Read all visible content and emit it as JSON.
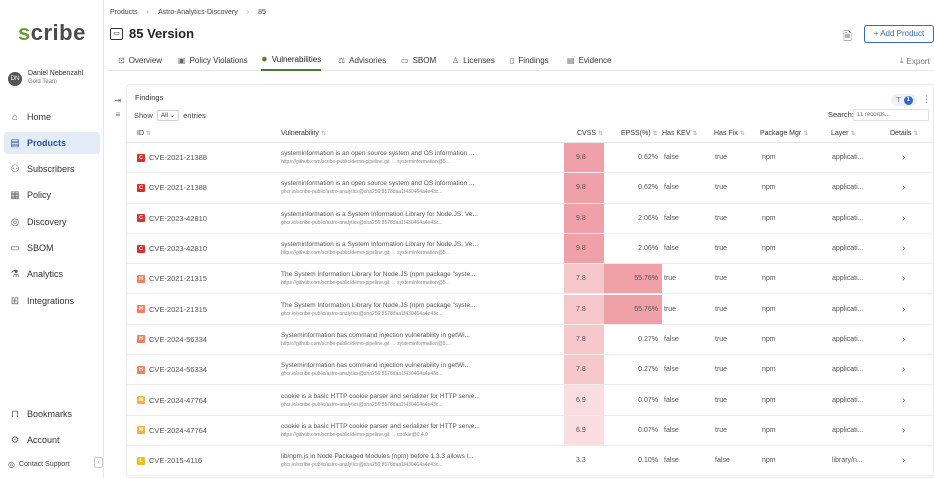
{
  "sidebar": {
    "logo_initial": "s",
    "logo_rest": "cribe",
    "user": {
      "initials": "DN",
      "name": "Daniel Nebenzahl",
      "team": "Gold Team"
    },
    "items": [
      {
        "label": "Home",
        "icon": "home-icon"
      },
      {
        "label": "Products",
        "icon": "products-icon",
        "active": true
      },
      {
        "label": "Subscribers",
        "icon": "subscribers-icon"
      },
      {
        "label": "Policy",
        "icon": "policy-icon"
      },
      {
        "label": "Discovery",
        "icon": "discovery-icon"
      },
      {
        "label": "SBOM",
        "icon": "sbom-icon"
      },
      {
        "label": "Analytics",
        "icon": "analytics-icon"
      },
      {
        "label": "Integrations",
        "icon": "integrations-icon"
      }
    ],
    "bottom": [
      {
        "label": "Bookmarks",
        "icon": "bookmark-icon"
      },
      {
        "label": "Account",
        "icon": "account-icon"
      }
    ],
    "contact_support": "Contact Support"
  },
  "header": {
    "breadcrumb": [
      "Products",
      "Astro-Analytics-Discovery",
      "85"
    ],
    "title": "85 Version",
    "add_product": "+ Add Product",
    "export": "Export"
  },
  "tabs": [
    {
      "label": "Overview",
      "icon": "overview-icon"
    },
    {
      "label": "Policy Violations",
      "icon": "policy-violations-icon"
    },
    {
      "label": "Vulnerabilities",
      "icon": "vulnerabilities-icon",
      "active": true
    },
    {
      "label": "Advisories",
      "icon": "advisories-icon"
    },
    {
      "label": "SBOM",
      "icon": "sbom-icon"
    },
    {
      "label": "Licenses",
      "icon": "licenses-icon"
    },
    {
      "label": "Findings",
      "icon": "findings-icon"
    },
    {
      "label": "Evidence",
      "icon": "evidence-icon"
    }
  ],
  "findings": {
    "title": "Findings",
    "show_label": "Show",
    "show_value": "All",
    "entries_label": "entries",
    "search_label": "Search:",
    "search_placeholder": "11 records...",
    "filter_count": "1",
    "columns": [
      "ID",
      "Vulnerability",
      "CVSS",
      "EPSS(%)",
      "Has KEV",
      "Has Fix",
      "Package Mgr",
      "Layer",
      "Details"
    ],
    "rows": [
      {
        "sev": "C",
        "sev_color": "#d9302c",
        "id": "CVE-2021-21388",
        "title": "systeminformation is an open source system and OS information ...",
        "src": "https://github.com/scribe-public/demo-pipeline.git → systeminformation@5...",
        "cvss": "9.8",
        "cvss_bg": "#f0a0a8",
        "epss": "0.62%",
        "epss_bg": "",
        "kev": "false",
        "fix": "true",
        "pm": "npm",
        "layer": "applicati..."
      },
      {
        "sev": "C",
        "sev_color": "#d9302c",
        "id": "CVE-2021-21388",
        "title": "systeminformation is an open source system and OS information ...",
        "src": "ghcr.io/scribe-public/astro-analytics@sha256:8578daa1f430464a4e43c...",
        "cvss": "9.8",
        "cvss_bg": "#f0a0a8",
        "epss": "0.62%",
        "epss_bg": "",
        "kev": "false",
        "fix": "true",
        "pm": "npm",
        "layer": "applicati..."
      },
      {
        "sev": "C",
        "sev_color": "#d9302c",
        "id": "CVE-2023-42810",
        "title": "systeminformation is a System Information Library for Node.JS. Ve...",
        "src": "ghcr.io/scribe-public/astro-analytics@sha256:8578daa1f430464a4e43c...",
        "cvss": "9.8",
        "cvss_bg": "#f0a0a8",
        "epss": "2.06%",
        "epss_bg": "",
        "kev": "false",
        "fix": "true",
        "pm": "npm",
        "layer": "applicati..."
      },
      {
        "sev": "C",
        "sev_color": "#d9302c",
        "id": "CVE-2023-42810",
        "title": "systeminformation is a System Information Library for Node.JS. Ve...",
        "src": "https://github.com/scribe-public/demo-pipeline.git → systeminformation@5...",
        "cvss": "9.8",
        "cvss_bg": "#f0a0a8",
        "epss": "2.06%",
        "epss_bg": "",
        "kev": "false",
        "fix": "true",
        "pm": "npm",
        "layer": "applicati..."
      },
      {
        "sev": "H",
        "sev_color": "#f08060",
        "id": "CVE-2021-21315",
        "title": "The System Information Library for Node.JS (npm package \"syste...",
        "src": "https://github.com/scribe-public/demo-pipeline.git → systeminformation@5...",
        "cvss": "7.8",
        "cvss_bg": "#f6c8cc",
        "epss": "55.76%",
        "epss_bg": "#f0a0a8",
        "kev": "true",
        "fix": "true",
        "pm": "npm",
        "layer": "applicati..."
      },
      {
        "sev": "H",
        "sev_color": "#f08060",
        "id": "CVE-2021-21315",
        "title": "The System Information Library for Node.JS (npm package \"syste...",
        "src": "ghcr.io/scribe-public/astro-analytics@sha256:8578daa1f430464a4e43c...",
        "cvss": "7.8",
        "cvss_bg": "#f6c8cc",
        "epss": "55.76%",
        "epss_bg": "#f0a0a8",
        "kev": "true",
        "fix": "true",
        "pm": "npm",
        "layer": "applicati..."
      },
      {
        "sev": "H",
        "sev_color": "#f08060",
        "id": "CVE-2024-56334",
        "title": "Systeminformation has command injection vulnerability in getWi...",
        "src": "https://github.com/scribe-public/demo-pipeline.git → systeminformation@5...",
        "cvss": "7.8",
        "cvss_bg": "#f6c8cc",
        "epss": "0.27%",
        "epss_bg": "",
        "kev": "false",
        "fix": "true",
        "pm": "npm",
        "layer": "applicati..."
      },
      {
        "sev": "H",
        "sev_color": "#f08060",
        "id": "CVE-2024-56334",
        "title": "Systeminformation has command injection vulnerability in getWi...",
        "src": "ghcr.io/scribe-public/astro-analytics@sha256:8578daa1f430464a4e43c...",
        "cvss": "7.8",
        "cvss_bg": "#f6c8cc",
        "epss": "0.27%",
        "epss_bg": "",
        "kev": "false",
        "fix": "true",
        "pm": "npm",
        "layer": "applicati..."
      },
      {
        "sev": "M",
        "sev_color": "#f5b041",
        "id": "CVE-2024-47764",
        "title": "cookie is a basic HTTP cookie parser and serializer for HTTP serve...",
        "src": "ghcr.io/scribe-public/astro-analytics@sha256:8578daa1f430464a4e43c...",
        "cvss": "6.9",
        "cvss_bg": "#f9dde0",
        "epss": "0.07%",
        "epss_bg": "",
        "kev": "false",
        "fix": "true",
        "pm": "npm",
        "layer": "applicati..."
      },
      {
        "sev": "M",
        "sev_color": "#f5b041",
        "id": "CVE-2024-47764",
        "title": "cookie is a basic HTTP cookie parser and serializer for HTTP serve...",
        "src": "https://github.com/scribe-public/demo-pipeline.git → cookie@0.4.0",
        "cvss": "6.9",
        "cvss_bg": "#f9dde0",
        "epss": "0.07%",
        "epss_bg": "",
        "kev": "false",
        "fix": "true",
        "pm": "npm",
        "layer": "applicati..."
      },
      {
        "sev": "L",
        "sev_color": "#e8c020",
        "id": "CVE-2015-4116",
        "title": "lib/npm.js in Node Packaged Modules (npm) before 1.3.3 allows l...",
        "src": "ghcr.io/scribe-public/astro-analytics@sha256:8578daa1f430464a4e43c...",
        "cvss": "3.3",
        "cvss_bg": "",
        "epss": "0.10%",
        "epss_bg": "",
        "kev": "false",
        "fix": "false",
        "pm": "npm",
        "layer": "library/n..."
      }
    ]
  }
}
